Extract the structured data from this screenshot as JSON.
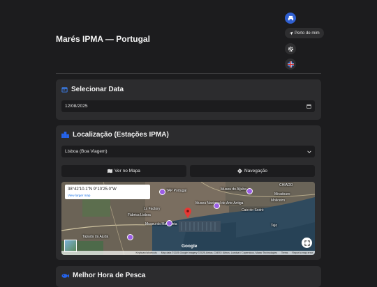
{
  "header": {
    "title": "Marés IPMA — Portugal",
    "near_me_label": "Perto de mim",
    "print_icon": "print-icon",
    "settings_icon": "gear-icon",
    "language_icon": "uk-flag-icon"
  },
  "date_section": {
    "title": "Selecionar Data",
    "icon": "calendar-icon",
    "date_value": "12/08/2025"
  },
  "location_section": {
    "title": "Localização (Estações IPMA)",
    "icon": "building-icon",
    "station_selected": "Lisboa (Boa Viagem)",
    "map_button": "Ver no Mapa",
    "navigation_button": "Navegação",
    "map": {
      "coords_text": "38°42'10.1\"N 9°10'25.0\"W",
      "larger_map_link": "View larger map",
      "google_label": "Google",
      "labels": [
        "Museu do Aljube",
        "CHIADO",
        "Miradouro",
        "Moliceiro",
        "TAP Portugal",
        "Museu Nacional de Arte Antiga",
        "Cais do Sodré",
        "Fábrica Lisboa",
        "Museu da Marioneta",
        "Tapada da Ajuda",
        "Lx Factory",
        "Tejo"
      ],
      "attribution": [
        "Keyboard shortcuts",
        "Map data ©2025 Google Imagery ©2025 Airbus, CNES / Airbus, Landsat / Copernicus, Maxar Technologies",
        "Terms",
        "Report a map error"
      ]
    }
  },
  "fishing_section": {
    "title": "Melhor Hora de Pesca",
    "icon": "fish-icon"
  },
  "colors": {
    "background": "#1c1c1e",
    "card": "#2c2c2e",
    "accent": "#2f5fd0",
    "marker": "#e53935"
  }
}
